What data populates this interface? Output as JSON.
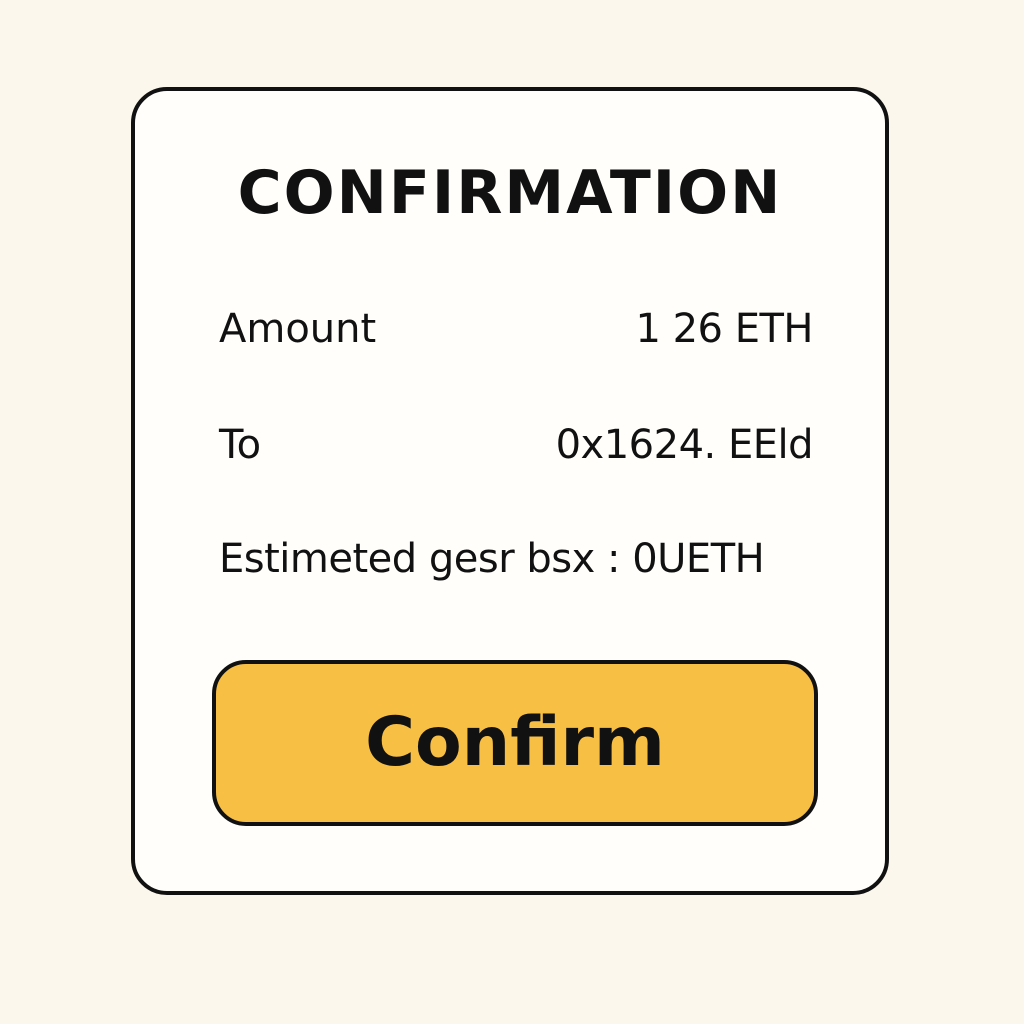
{
  "dialog": {
    "title": "CONFIRMATION",
    "rows": [
      {
        "label": "Amount",
        "value": "1 26 ETH"
      },
      {
        "label": "To",
        "value": "0x1624. EEld"
      },
      {
        "label": "Estimeted gesr bsx : 0UETH",
        "value": ""
      }
    ],
    "confirm_label": "Confirm"
  },
  "colors": {
    "page_background": "#fcf7ec",
    "dialog_background": "#fffefb",
    "border": "#111111",
    "button_fill": "#f8bf45"
  }
}
